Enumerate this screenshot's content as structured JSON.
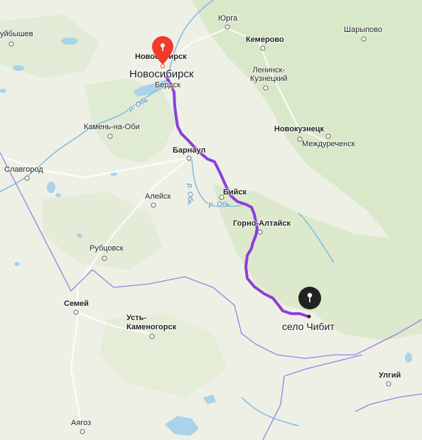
{
  "map": {
    "colors": {
      "land": "#eef0e6",
      "forest": "#d9e8c9",
      "water": "#a9d3ea",
      "route": "#8c3fd9",
      "start_pin": "#f23a2a",
      "end_pin": "#222222",
      "border": "#9b7fe0"
    },
    "cities": {
      "kuybyshev": "уйбышев",
      "yurga": "Юрга",
      "kemerovo": "Кемерово",
      "sharypovo": "Шарыпово",
      "novosibirsk_small": "Новосибирск",
      "leninsk": "Ленинск-\nКузнецкий",
      "berdsk": "Бердск",
      "kamen": "Камень-на-Оби",
      "novokuznetsk": "Новокузнецк",
      "mezhdurechensk": "Междуреченск",
      "barnaul": "Барнаул",
      "slavgorod": "Славгород",
      "aleysk": "Алейск",
      "biysk": "Бийск",
      "gorno": "Горно-Алтайск",
      "rubtsovsk": "Рубцовск",
      "semey": "Семей",
      "ust_kam": "Усть-\nКаменогорск",
      "ulgiy": "Улгий",
      "ayagoz": "Аягоз"
    },
    "rivers": {
      "ob_north": "р. Обь",
      "ob_vertical": "р. Обь",
      "ob_south": "р. Обь"
    },
    "route": {
      "start_label": "Новосибирск",
      "end_label": "село Чибит",
      "start_icon": "location-pin-icon",
      "end_icon": "location-pin-icon"
    }
  }
}
